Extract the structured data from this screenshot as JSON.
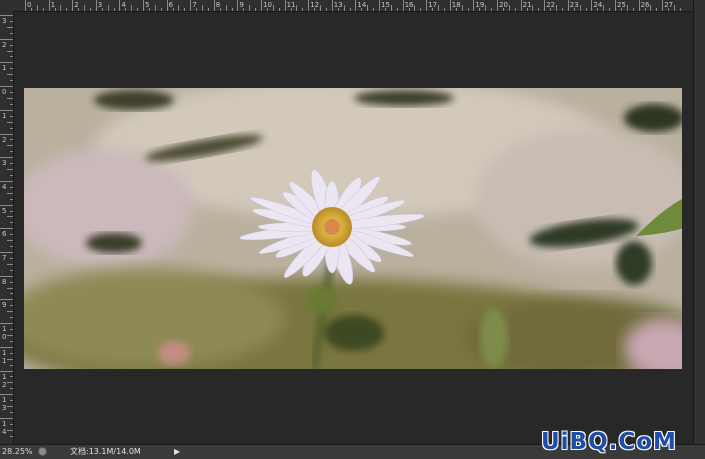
{
  "rulers": {
    "top_labels": [
      "0",
      "1",
      "2",
      "3",
      "4",
      "5",
      "6",
      "7",
      "8",
      "9",
      "10",
      "11",
      "12",
      "13",
      "14",
      "15",
      "16",
      "17",
      "18",
      "19",
      "20",
      "21",
      "22",
      "23",
      "24",
      "25",
      "26",
      "27"
    ],
    "left_labels": [
      "3",
      "2",
      "1",
      "0",
      "1",
      "2",
      "3",
      "4",
      "5",
      "6",
      "7",
      "8",
      "9",
      "1\n0",
      "1\n1",
      "1\n2",
      "1\n3",
      "1\n4"
    ]
  },
  "status": {
    "zoom": "28.25%",
    "doc_info": "文档:13.1M/14.0M",
    "arrow": "▶"
  },
  "watermark": "UiBQ.CoM",
  "colors": {
    "background": "#282828",
    "ruler": "#2f2f2f",
    "watermark": "#1f4ea8"
  }
}
